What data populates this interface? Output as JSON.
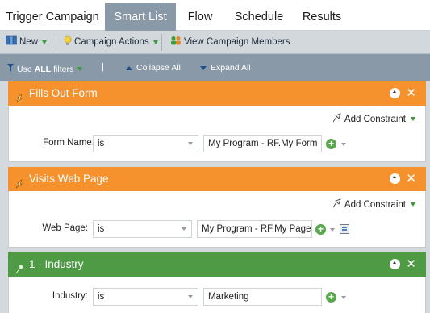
{
  "tabs": [
    {
      "label": "Trigger Campaign",
      "active": false
    },
    {
      "label": "Smart List",
      "active": true
    },
    {
      "label": "Flow",
      "active": false
    },
    {
      "label": "Schedule",
      "active": false
    },
    {
      "label": "Results",
      "active": false
    }
  ],
  "toolbar": {
    "new_label": "New",
    "campaign_actions_label": "Campaign Actions",
    "view_members_label": "View Campaign Members"
  },
  "filterbar": {
    "use_prefix": "Use",
    "use_bold": "ALL",
    "use_suffix": "filters",
    "separator": "|",
    "collapse_label": "Collapse All",
    "expand_label": "Expand All"
  },
  "filters": [
    {
      "title": "Fills Out Form",
      "color": "#f6922e",
      "add_constraint": "Add Constraint",
      "field_label": "Form Name:",
      "operator": "is",
      "value": "My Program - RF.My Form"
    },
    {
      "title": "Visits Web Page",
      "color": "#f6922e",
      "add_constraint": "Add Constraint",
      "field_label": "Web Page:",
      "operator": "is",
      "value": "My Program - RF.My Page"
    },
    {
      "title": "1 - Industry",
      "color": "#4f9a45",
      "field_label": "Industry:",
      "operator": "is",
      "value": "Marketing"
    }
  ],
  "colors": {
    "accent_orange": "#f6922e",
    "accent_green": "#4f9a45",
    "tab_active": "#8a99a7"
  }
}
